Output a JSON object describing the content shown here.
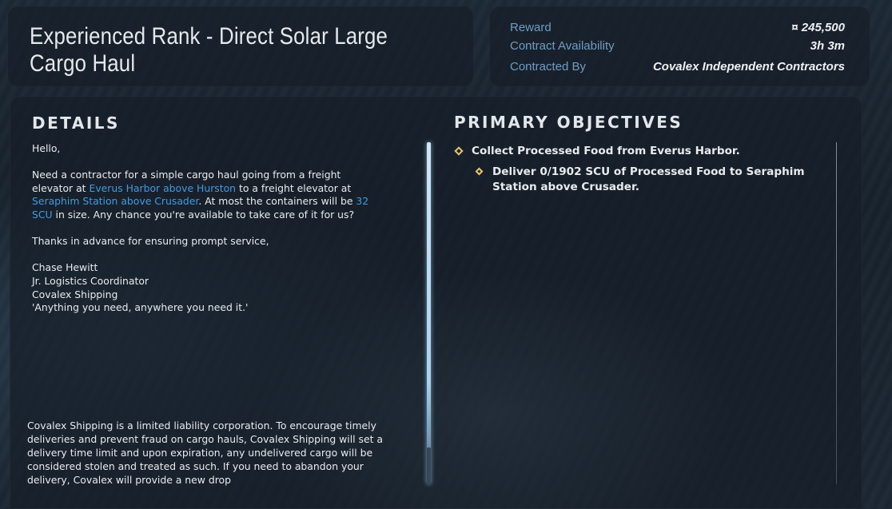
{
  "title": "Experienced Rank - Direct Solar Large Cargo Haul",
  "summary": {
    "reward_label": "Reward",
    "reward_currency_icon": "¤",
    "reward_value": "245,500",
    "availability_label": "Contract Availability",
    "availability_value": "3h 3m",
    "contracted_by_label": "Contracted By",
    "contracted_by_value": "Covalex Independent Contractors"
  },
  "details": {
    "heading": "DETAILS",
    "greeting": "Hello,",
    "body_1": "Need a contractor for a simple cargo haul going from a freight elevator at ",
    "pickup_link": "Everus Harbor above Hurston",
    "body_2": " to a freight elevator at ",
    "dropoff_link": "Seraphim Station above Crusader",
    "body_3": ". At most the containers will be ",
    "size_link": "32 SCU",
    "body_4": " in size. Any chance you're available to take care of it for us?",
    "thanks": "Thanks in advance for ensuring prompt service,",
    "sig_name": "Chase Hewitt",
    "sig_title": "Jr. Logistics Coordinator",
    "sig_company": "Covalex Shipping",
    "sig_motto": "'Anything you need, anywhere you need it.'",
    "legal": "Covalex Shipping is a limited liability corporation. To encourage timely deliveries and prevent fraud on cargo hauls, Covalex Shipping will set a delivery time limit and upon expiration, any undelivered cargo will be considered stolen and treated as such. If you need to abandon your delivery, Covalex will provide a new drop"
  },
  "objectives": {
    "heading": "PRIMARY OBJECTIVES",
    "items": [
      "Collect Processed Food from Everus Harbor.",
      "Deliver 0/1902 SCU of Processed Food to Seraphim Station above Crusader."
    ]
  },
  "colors": {
    "accent_link": "#3f9be4",
    "label_blue": "#6f9cc4",
    "objective_marker": "#e8c86a"
  }
}
